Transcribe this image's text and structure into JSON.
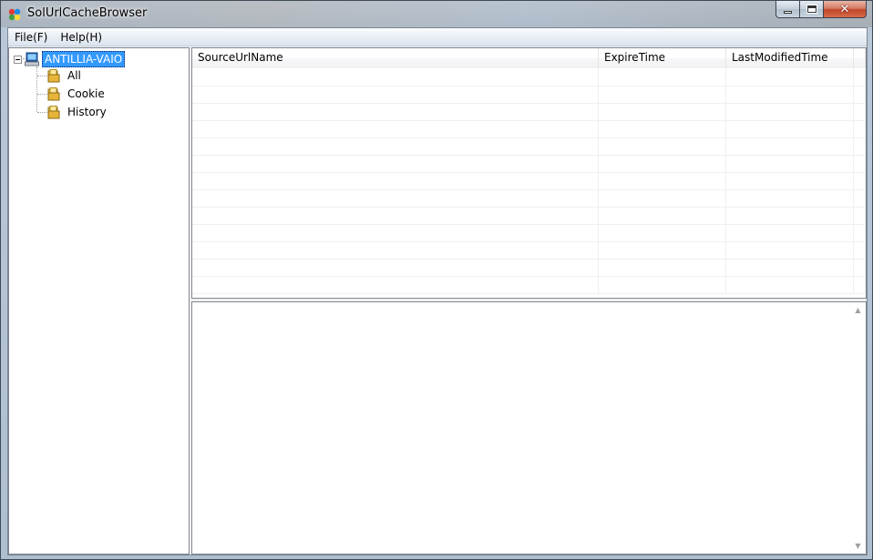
{
  "window": {
    "title": "SolUrlCacheBrowser"
  },
  "menu": {
    "items": [
      {
        "label": "File(F)"
      },
      {
        "label": "Help(H)"
      }
    ]
  },
  "tree": {
    "root": {
      "label": "ANTILLIA-VAIO",
      "icon": "computer-icon",
      "selected": true
    },
    "children": [
      {
        "label": "All",
        "icon": "folder-icon"
      },
      {
        "label": "Cookie",
        "icon": "folder-icon"
      },
      {
        "label": "History",
        "icon": "folder-icon"
      }
    ]
  },
  "list": {
    "columns": [
      {
        "label": "SourceUrlName"
      },
      {
        "label": "ExpireTime"
      },
      {
        "label": "LastModifiedTime"
      }
    ],
    "rows": []
  },
  "detail": {
    "content": ""
  },
  "colors": {
    "selection": "#3399ff",
    "close_button": "#c1462a"
  }
}
